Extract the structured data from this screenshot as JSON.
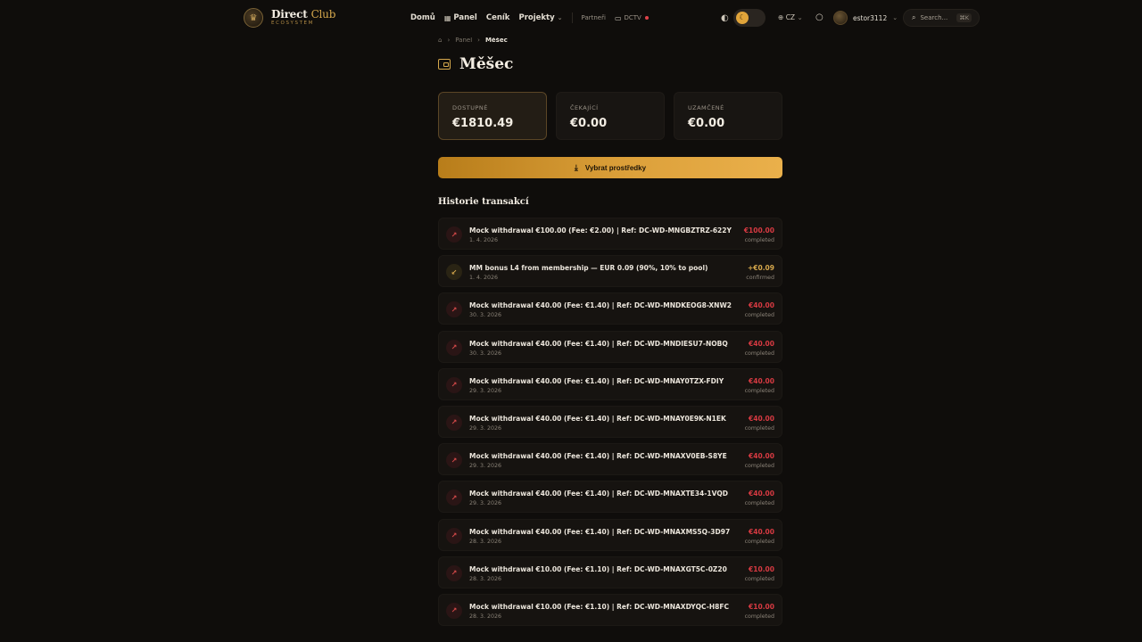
{
  "brand": {
    "title_main": "Direct",
    "title_accent": "Club",
    "subtitle": "ECOSYSTEM"
  },
  "nav": {
    "home": "Domů",
    "panel": "Panel",
    "pricing": "Ceník",
    "projects": "Projekty",
    "partners": "Partneři",
    "dctv": "DCTV"
  },
  "header": {
    "language": "CZ",
    "username": "estor3112",
    "search_placeholder": "Search...",
    "search_shortcut": "⌘K"
  },
  "breadcrumb": {
    "parent": "Panel",
    "current": "Měšec"
  },
  "page": {
    "title": "Měšec"
  },
  "balances": [
    {
      "label": "DOSTUPNÉ",
      "value": "€1810.49"
    },
    {
      "label": "ČEKAJÍCÍ",
      "value": "€0.00"
    },
    {
      "label": "UZAMČENÉ",
      "value": "€0.00"
    }
  ],
  "withdraw_button": "Vybrat prostředky",
  "history": {
    "title": "Historie transakcí",
    "items": [
      {
        "type": "out",
        "desc": "Mock withdrawal €100.00 (Fee: €2.00) | Ref: DC-WD-MNGBZTRZ-622Y",
        "date": "1. 4. 2026",
        "amount": "€100.00",
        "status": "completed"
      },
      {
        "type": "in",
        "desc": "MM bonus L4 from membership — EUR 0.09 (90%, 10% to pool)",
        "date": "1. 4. 2026",
        "amount": "+€0.09",
        "status": "confirmed"
      },
      {
        "type": "out",
        "desc": "Mock withdrawal €40.00 (Fee: €1.40) | Ref: DC-WD-MNDKEOG8-XNW2",
        "date": "30. 3. 2026",
        "amount": "€40.00",
        "status": "completed"
      },
      {
        "type": "out",
        "desc": "Mock withdrawal €40.00 (Fee: €1.40) | Ref: DC-WD-MNDIESU7-NOBQ",
        "date": "30. 3. 2026",
        "amount": "€40.00",
        "status": "completed"
      },
      {
        "type": "out",
        "desc": "Mock withdrawal €40.00 (Fee: €1.40) | Ref: DC-WD-MNAY0TZX-FDIY",
        "date": "29. 3. 2026",
        "amount": "€40.00",
        "status": "completed"
      },
      {
        "type": "out",
        "desc": "Mock withdrawal €40.00 (Fee: €1.40) | Ref: DC-WD-MNAY0E9K-N1EK",
        "date": "29. 3. 2026",
        "amount": "€40.00",
        "status": "completed"
      },
      {
        "type": "out",
        "desc": "Mock withdrawal €40.00 (Fee: €1.40) | Ref: DC-WD-MNAXV0EB-S8YE",
        "date": "29. 3. 2026",
        "amount": "€40.00",
        "status": "completed"
      },
      {
        "type": "out",
        "desc": "Mock withdrawal €40.00 (Fee: €1.40) | Ref: DC-WD-MNAXTE34-1VQD",
        "date": "29. 3. 2026",
        "amount": "€40.00",
        "status": "completed"
      },
      {
        "type": "out",
        "desc": "Mock withdrawal €40.00 (Fee: €1.40) | Ref: DC-WD-MNAXMS5Q-3D97",
        "date": "28. 3. 2026",
        "amount": "€40.00",
        "status": "completed"
      },
      {
        "type": "out",
        "desc": "Mock withdrawal €10.00 (Fee: €1.10) | Ref: DC-WD-MNAXGT5C-0Z20",
        "date": "28. 3. 2026",
        "amount": "€10.00",
        "status": "completed"
      },
      {
        "type": "out",
        "desc": "Mock withdrawal €10.00 (Fee: €1.10) | Ref: DC-WD-MNAXDYQC-H8FC",
        "date": "28. 3. 2026",
        "amount": "€10.00",
        "status": "completed"
      }
    ]
  },
  "colors": {
    "accent": "#d6a84c",
    "negative": "#d83a42",
    "background": "#0f0d0b"
  }
}
